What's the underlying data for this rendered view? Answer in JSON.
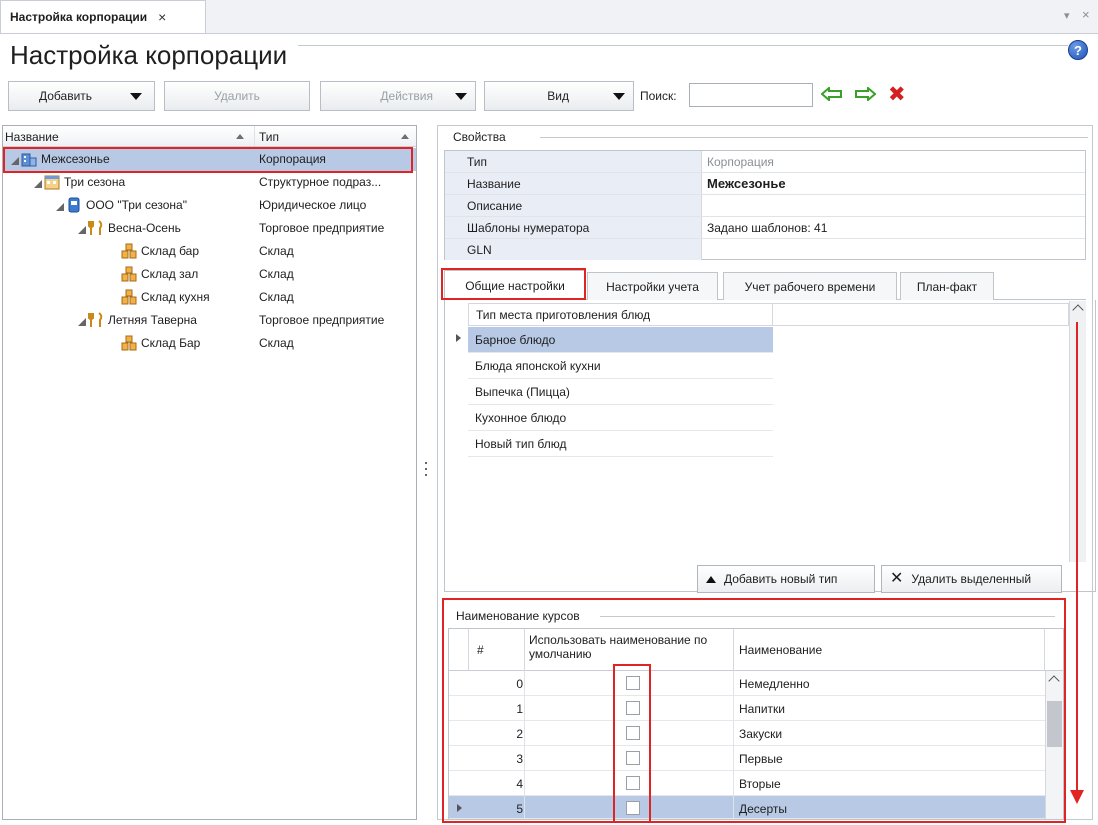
{
  "window": {
    "tab_title": "Настройка корпорации",
    "tab_close": "×",
    "title": "Настройка корпорации",
    "help_glyph": "?",
    "strip_dropdown": "▾",
    "strip_close": "×"
  },
  "toolbar": {
    "add_label": "Добавить",
    "delete_label": "Удалить",
    "actions_label": "Действия",
    "view_label": "Вид",
    "search_label": "Поиск:",
    "search_value": "",
    "search_placeholder": ""
  },
  "tree": {
    "col_name": "Название",
    "col_type": "Тип",
    "rows": [
      {
        "name": "Межсезонье",
        "type": "Корпорация"
      },
      {
        "name": "Три сезона",
        "type": "Структурное подраз..."
      },
      {
        "name": "ООО \"Три сезона\"",
        "type": "Юридическое лицо"
      },
      {
        "name": "Весна-Осень",
        "type": "Торговое предприятие"
      },
      {
        "name": "Склад бар",
        "type": "Склад"
      },
      {
        "name": "Склад зал",
        "type": "Склад"
      },
      {
        "name": "Склад кухня",
        "type": "Склад"
      },
      {
        "name": "Летняя Таверна",
        "type": "Торговое предприятие"
      },
      {
        "name": "Склад Бар",
        "type": "Склад"
      }
    ]
  },
  "properties": {
    "group_title": "Свойства",
    "rows": [
      {
        "key": "Тип",
        "value": "Корпорация"
      },
      {
        "key": "Название",
        "value": "Межсезонье"
      },
      {
        "key": "Описание",
        "value": ""
      },
      {
        "key": "Шаблоны нумератора",
        "value": "Задано шаблонов: 41"
      },
      {
        "key": "GLN",
        "value": ""
      }
    ]
  },
  "tabs": [
    "Общие настройки",
    "Настройки учета",
    "Учет рабочего времени",
    "План-факт"
  ],
  "dish_types": {
    "header": "Тип места приготовления блюд",
    "items": [
      "Барное блюдо",
      "Блюда японской кухни",
      "Выпечка (Пицца)",
      "Кухонное блюдо",
      "Новый тип блюд"
    ],
    "add_button": "Добавить новый тип",
    "delete_button": "Удалить выделенный"
  },
  "courses": {
    "group_title": "Наименование курсов",
    "col_num": "#",
    "col_default": "Использовать наименование по умолчанию",
    "col_name": "Наименование",
    "rows": [
      {
        "num": "0",
        "name": "Немедленно"
      },
      {
        "num": "1",
        "name": "Напитки"
      },
      {
        "num": "2",
        "name": "Закуски"
      },
      {
        "num": "3",
        "name": "Первые"
      },
      {
        "num": "4",
        "name": "Вторые"
      },
      {
        "num": "5",
        "name": "Десерты"
      }
    ]
  },
  "colors": {
    "selection": "#b7c9e4",
    "annotation_red": "#e02424",
    "nav_arrow_green": "#3aa02a"
  }
}
